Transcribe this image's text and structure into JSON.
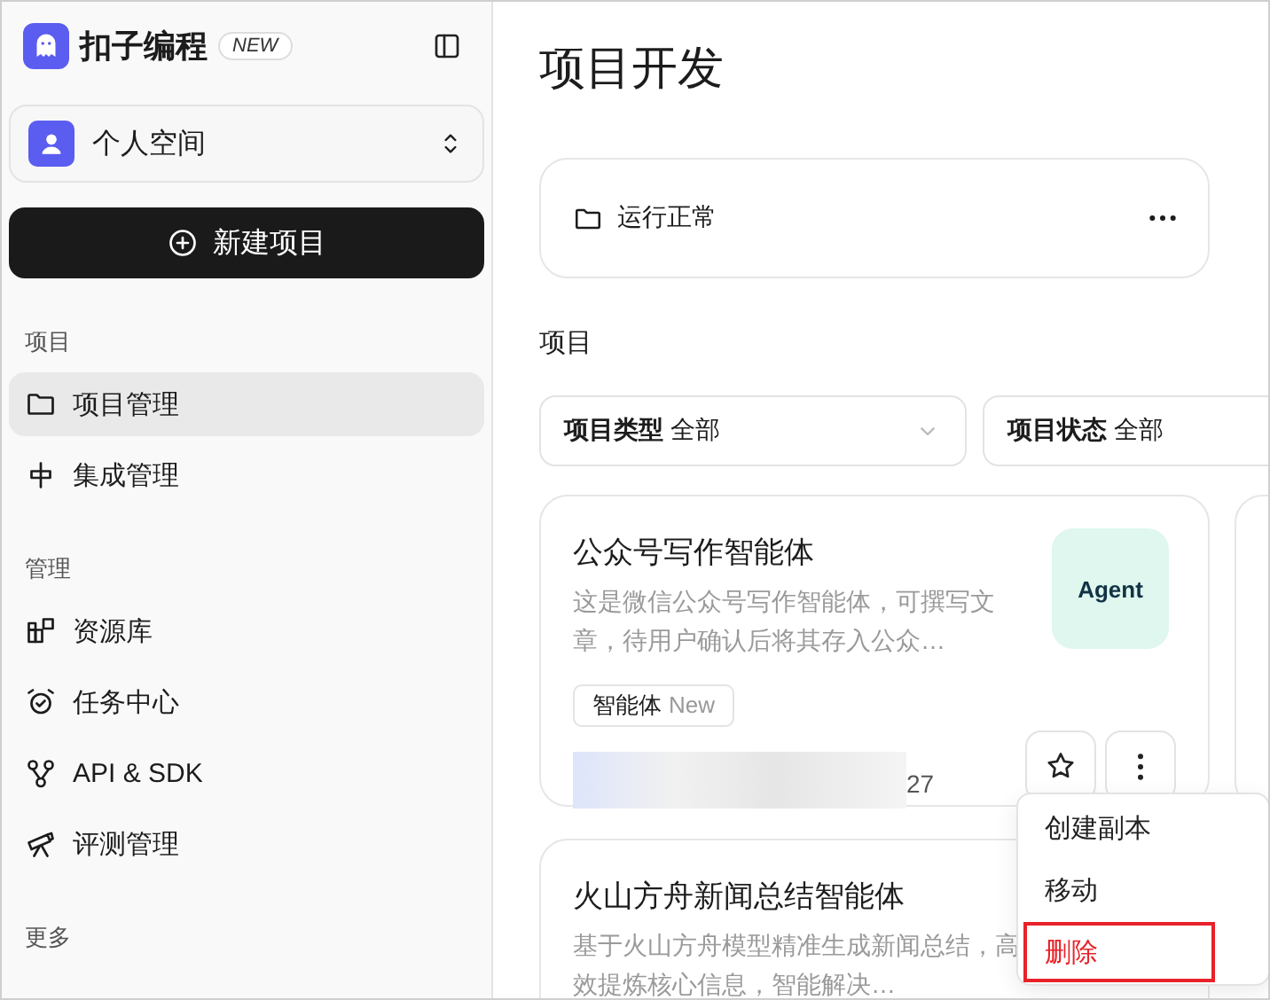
{
  "brand": {
    "name": "扣子编程",
    "badge": "NEW"
  },
  "workspace": {
    "name": "个人空间"
  },
  "new_button": {
    "label": "新建项目"
  },
  "sidebar": {
    "sections": [
      {
        "title": "项目",
        "items": [
          {
            "label": "项目管理",
            "selected": true
          },
          {
            "label": "集成管理",
            "selected": false
          }
        ]
      },
      {
        "title": "管理",
        "items": [
          {
            "label": "资源库",
            "selected": false
          },
          {
            "label": "任务中心",
            "selected": false
          },
          {
            "label": "API & SDK",
            "selected": false
          },
          {
            "label": "评测管理",
            "selected": false
          }
        ]
      },
      {
        "title": "更多"
      }
    ]
  },
  "page": {
    "title": "项目开发"
  },
  "status_card": {
    "label": "运行正常"
  },
  "section_title": "项目",
  "filters": [
    {
      "label": "项目类型",
      "value": "全部"
    },
    {
      "label": "项目状态",
      "value": "全部"
    }
  ],
  "projects": [
    {
      "title": "公众号写作智能体",
      "description": "这是微信公众号写作智能体，可撰写文章，待用户确认后将其存入公众…",
      "image_text": "Agent",
      "tag": "智能体",
      "tag_note": "New",
      "meta": "27",
      "starred": false
    },
    {
      "title": "火山方舟新闻总结智能体",
      "description": "基于火山方舟模型精准生成新闻总结，高效提炼核心信息，智能解决…"
    }
  ],
  "menu": [
    {
      "label": "创建副本",
      "kind": "normal",
      "highlighted": false
    },
    {
      "label": "移动",
      "kind": "normal",
      "highlighted": false
    },
    {
      "label": "删除",
      "kind": "danger",
      "highlighted": true
    }
  ]
}
